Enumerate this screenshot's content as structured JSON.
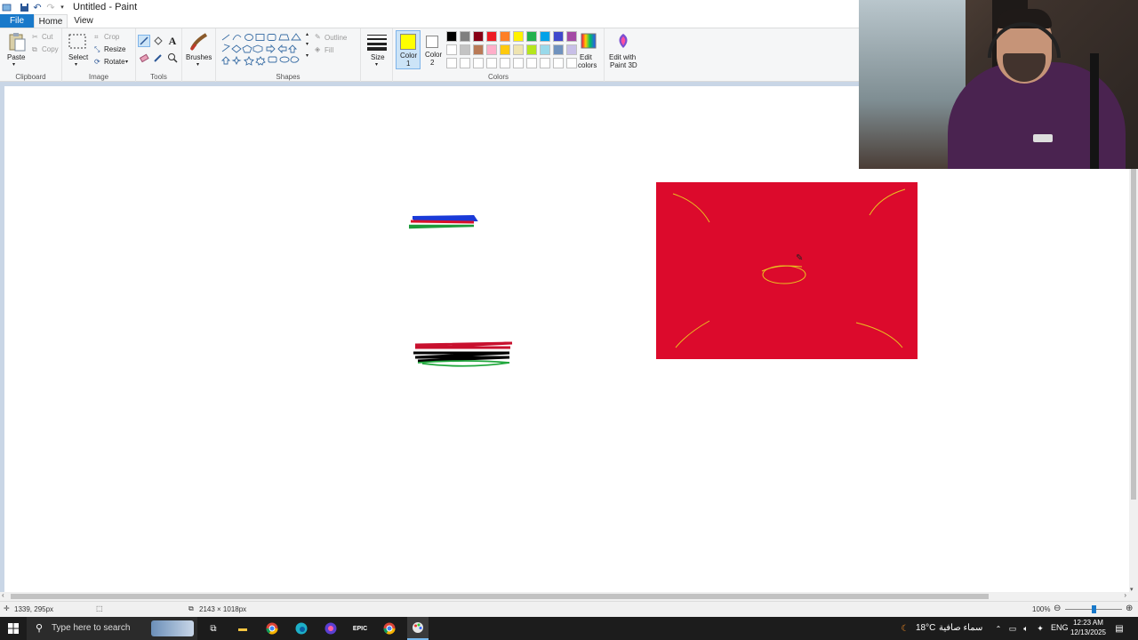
{
  "app": {
    "title": "Untitled - Paint"
  },
  "tabs": {
    "file": "File",
    "home": "Home",
    "view": "View"
  },
  "ribbon": {
    "clipboard": {
      "label": "Clipboard",
      "paste": "Paste",
      "cut": "Cut",
      "copy": "Copy"
    },
    "image": {
      "label": "Image",
      "select": "Select",
      "crop": "Crop",
      "resize": "Resize",
      "rotate": "Rotate"
    },
    "tools": {
      "label": "Tools"
    },
    "brushes": {
      "label": "Brushes"
    },
    "shapes": {
      "label": "Shapes",
      "outline": "Outline",
      "fill": "Fill"
    },
    "size": {
      "label": "Size"
    },
    "colors": {
      "label": "Colors",
      "color1_line1": "Color",
      "color1_line2": "1",
      "color2_line1": "Color",
      "color2_line2": "2",
      "color1_value": "#ffff00",
      "color2_value": "#ffffff",
      "palette_row1": [
        "#000000",
        "#7f7f7f",
        "#880015",
        "#ed1c24",
        "#ff7f27",
        "#fff200",
        "#22b14c",
        "#00a2e8",
        "#3f48cc",
        "#a349a4"
      ],
      "palette_row2": [
        "#ffffff",
        "#c3c3c3",
        "#b97a57",
        "#ffaec9",
        "#ffc90e",
        "#efe4b0",
        "#b5e61d",
        "#99d9ea",
        "#7092be",
        "#c8bfe7"
      ],
      "edit_line1": "Edit",
      "edit_line2": "colors"
    },
    "paint3d": {
      "line1": "Edit with",
      "line2": "Paint 3D"
    }
  },
  "status": {
    "cursor_pos": "1339, 295px",
    "image_size": "2143 × 1018px",
    "zoom": "100%"
  },
  "taskbar": {
    "search_placeholder": "Type here to search",
    "weather_temp": "18°C",
    "weather_text": "سماء صافية",
    "language": "ENG",
    "time": "12:23 AM",
    "date": "12/13/2025"
  },
  "canvas": {
    "red_rect_color": "#dc0a2c"
  }
}
